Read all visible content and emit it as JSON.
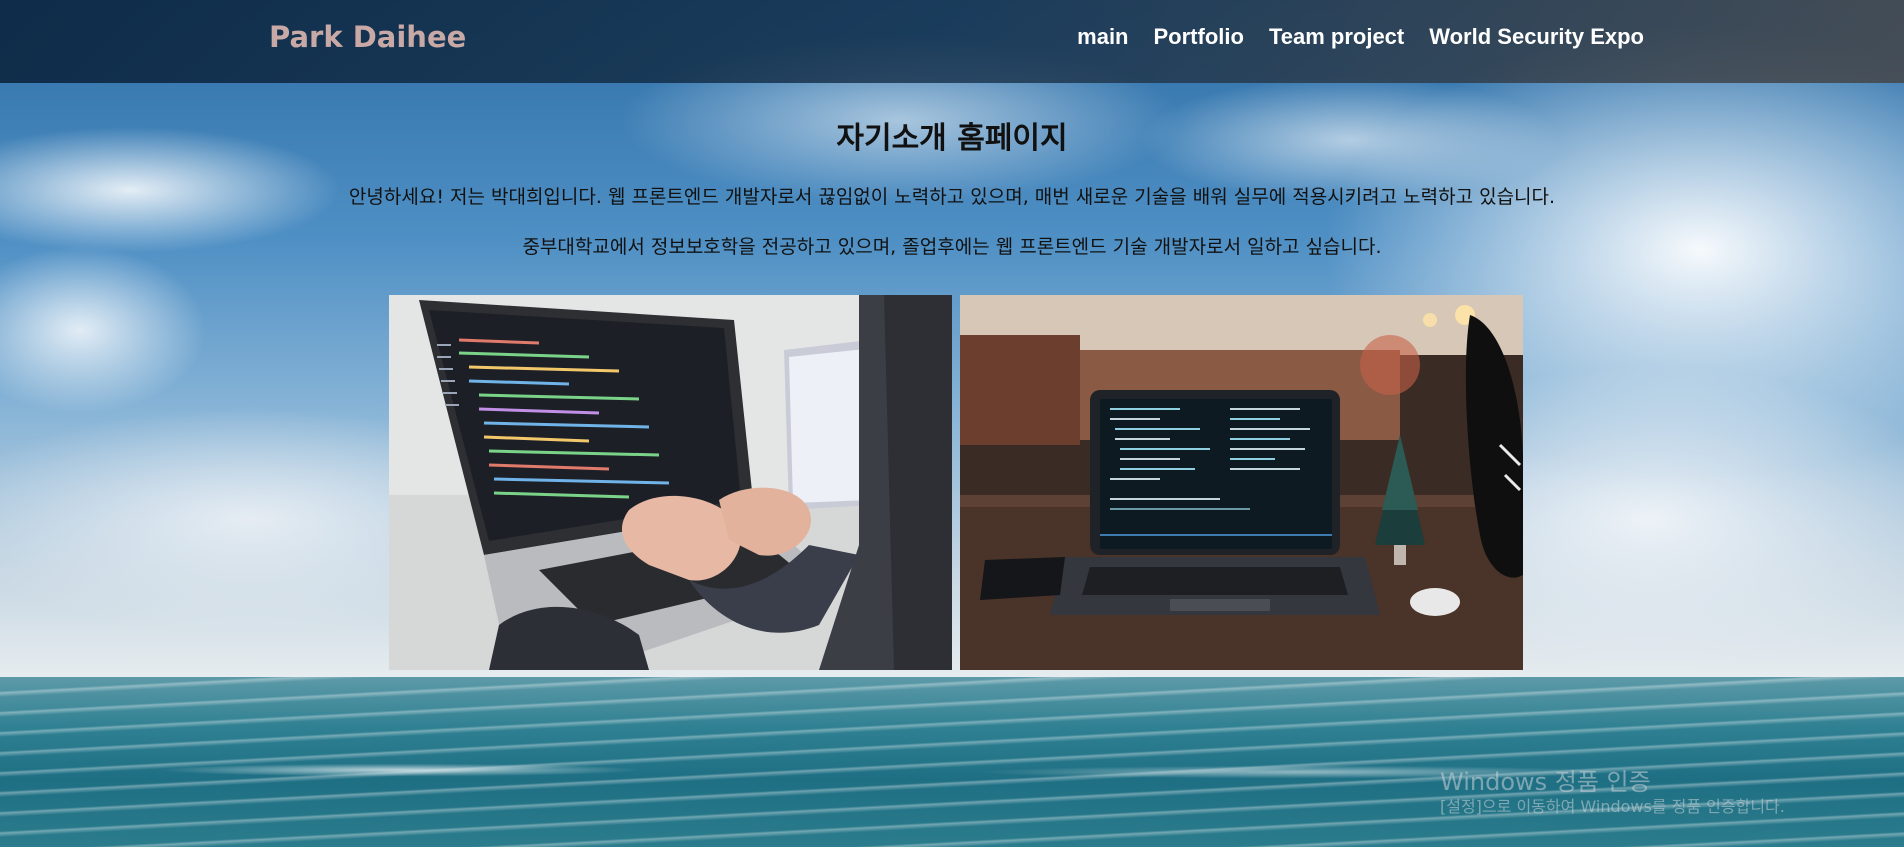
{
  "header": {
    "brand": "Park Daihee",
    "nav": [
      "main",
      "Portfolio",
      "Team project",
      "World Security Expo"
    ]
  },
  "main": {
    "title": "자기소개 홈페이지",
    "intro_1": "안녕하세요! 저는 박대희입니다. 웹 프론트엔드 개발자로서 끊임없이 노력하고 있으며, 매번 새로운 기술을 배워 실무에 적용시키려고 노력하고 있습니다.",
    "intro_2": "중부대학교에서 정보보호학을 전공하고 있으며, 졸업후에는 웹 프론트엔드 기술 개발자로서 일하고 싶습니다."
  },
  "watermark": {
    "line1": "Windows 정품 인증",
    "line2": "[설정]으로 이동하여 Windows를 정품 인증합니다."
  },
  "colors": {
    "brand": "#c9a9a6",
    "nav_text": "#ffffff",
    "header_bg": "#1b3551"
  }
}
